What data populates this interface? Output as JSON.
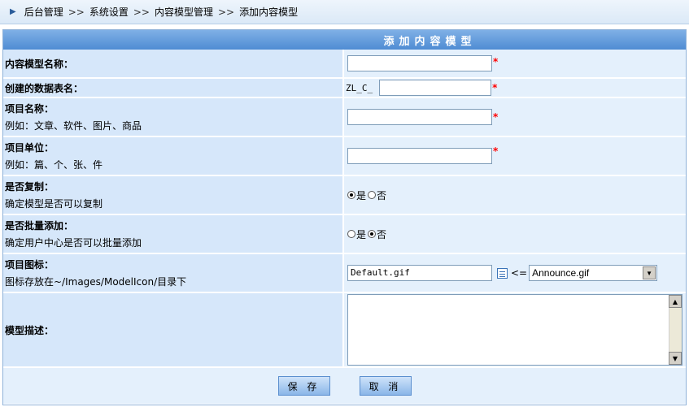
{
  "breadcrumb": {
    "items": [
      "后台管理",
      "系统设置",
      "内容模型管理",
      "添加内容模型"
    ],
    "separator": ">>"
  },
  "form": {
    "title": "添加内容模型",
    "rows": [
      {
        "label": "内容模型名称：",
        "hint": "",
        "value": ""
      },
      {
        "label": "创建的数据表名：",
        "hint": "",
        "prefix": "ZL_C_",
        "value": ""
      },
      {
        "label": "项目名称：",
        "hint": "例如：文章、软件、图片、商品",
        "value": ""
      },
      {
        "label": "项目单位：",
        "hint": "例如：篇、个、张、件",
        "value": ""
      },
      {
        "label": "是否复制：",
        "hint": "确定模型是否可以复制",
        "options": [
          "是",
          "否"
        ],
        "selected": "是"
      },
      {
        "label": "是否批量添加：",
        "hint": "确定用户中心是否可以批量添加",
        "options": [
          "是",
          "否"
        ],
        "selected": "否"
      },
      {
        "label": "项目图标：",
        "hint": "图标存放在~/Images/ModelIcon/目录下",
        "value": "Default.gif",
        "arrow": "<=",
        "select_value": "Announce.gif"
      },
      {
        "label": "模型描述：",
        "hint": "",
        "value": ""
      }
    ],
    "required_mark": "*",
    "save_label": "保 存",
    "cancel_label": "取 消"
  },
  "colors": {
    "label_bg": "#d6e7fa",
    "value_bg": "#e4f0fc",
    "title_bg": "#4f8cd3",
    "required": "#ff0000"
  }
}
